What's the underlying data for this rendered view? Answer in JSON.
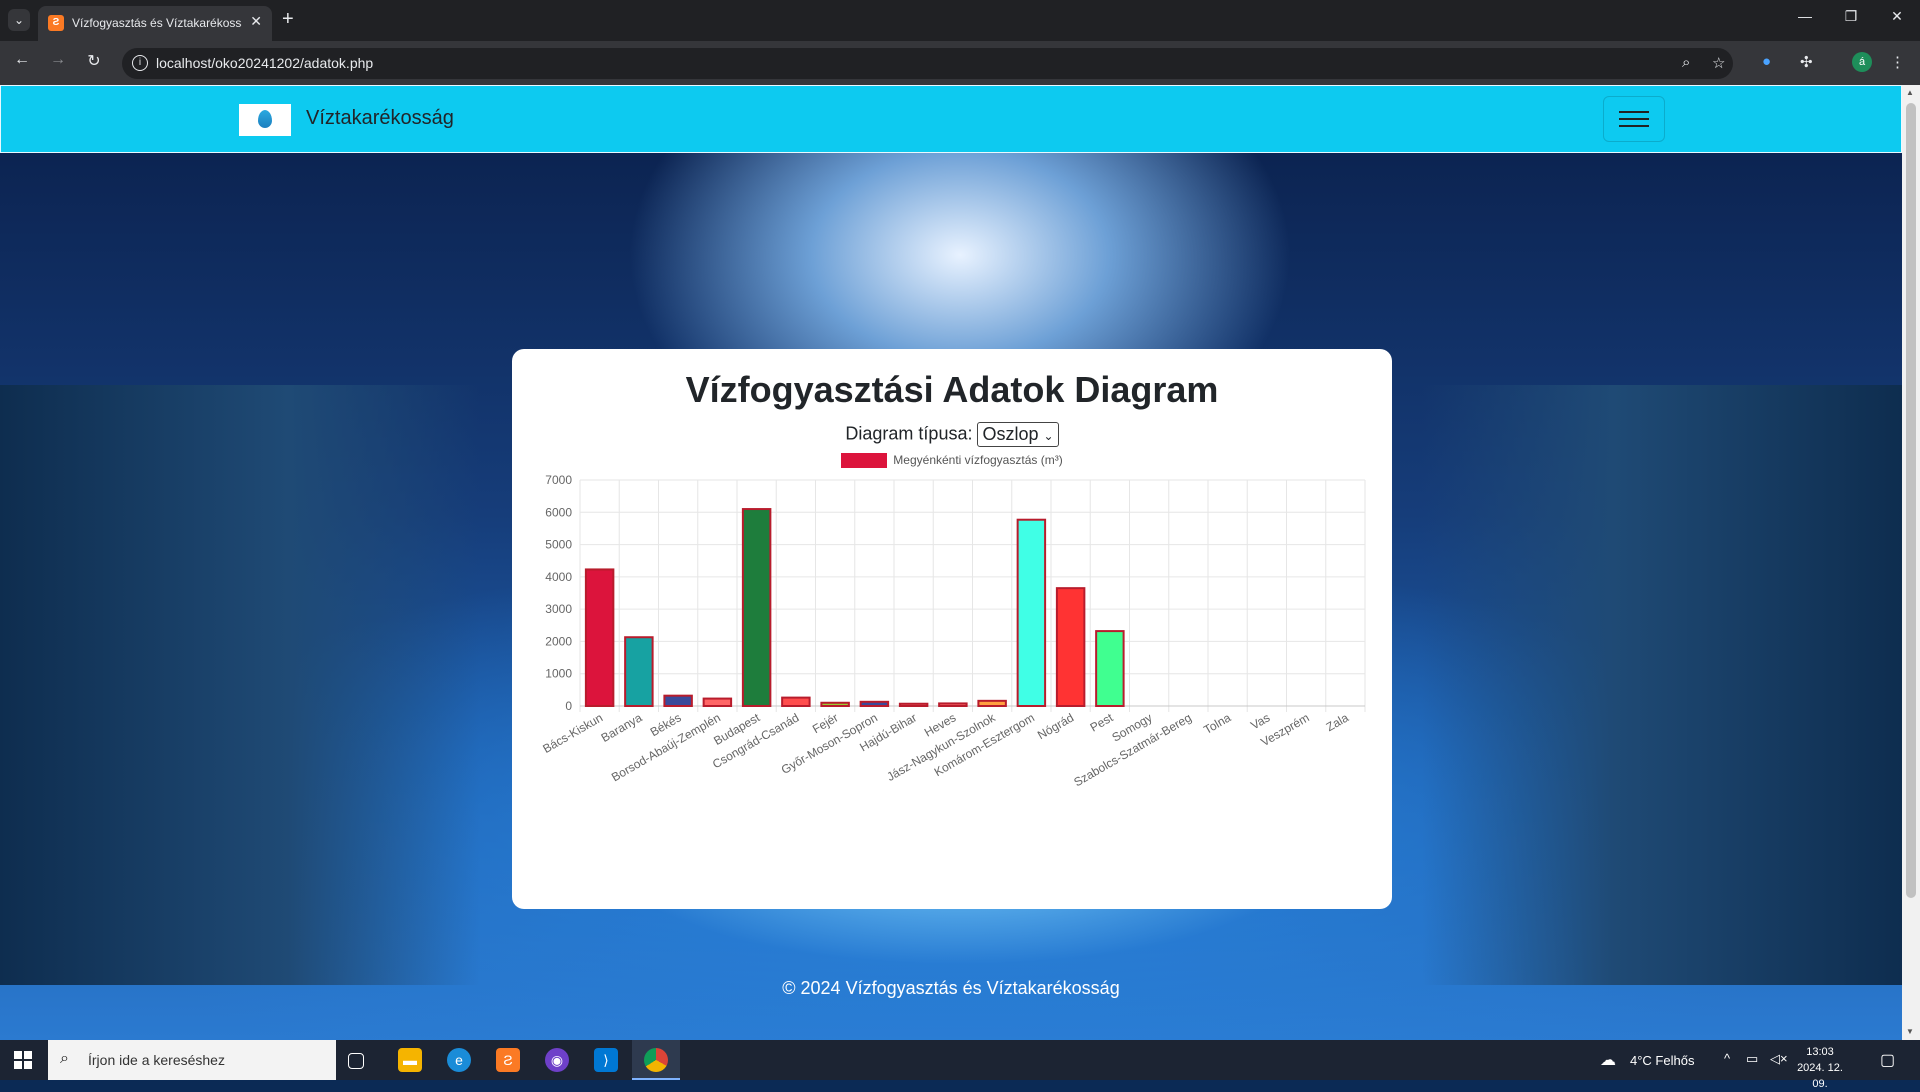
{
  "browser": {
    "tab_title": "Vízfogyasztás és Víztakarékosság",
    "tab_favicon": "xampp-icon",
    "url": "localhost/oko20241202/adatok.php",
    "profile_initial": "á"
  },
  "navbar": {
    "brand": "Víztakarékosság"
  },
  "card": {
    "title": "Vízfogyasztási Adatok Diagram",
    "type_label": "Diagram típusa:",
    "type_selected": "Oszlop"
  },
  "chart_data": {
    "type": "bar",
    "legend": [
      "Megyénkénti vízfogyasztás (m³)"
    ],
    "categories": [
      "Bács-Kiskun",
      "Baranya",
      "Békés",
      "Borsod-Abaúj-Zemplén",
      "Budapest",
      "Csongrád-Csanád",
      "Fejér",
      "Győr-Moson-Sopron",
      "Hajdú-Bihar",
      "Heves",
      "Jász-Nagykun-Szolnok",
      "Komárom-Esztergom",
      "Nógrád",
      "Pest",
      "Somogy",
      "Szabolcs-Szatmár-Bereg",
      "Tolna",
      "Vas",
      "Veszprém",
      "Zala"
    ],
    "series": [
      {
        "name": "Megyénkénti vízfogyasztás (m³)",
        "values": [
          4230,
          2130,
          320,
          230,
          6100,
          260,
          100,
          130,
          70,
          80,
          160,
          5770,
          3650,
          2320,
          0,
          0,
          0,
          0,
          0,
          0
        ]
      }
    ],
    "colors": [
      "#dc143c",
      "#17a2a2",
      "#3a4a9a",
      "#ff6666",
      "#1e7d3c",
      "#ff4d4d",
      "#9acd32",
      "#3a4a9a",
      "#ff6666",
      "#ff6666",
      "#ffa040",
      "#40ffe6",
      "#ff3333",
      "#40ff90",
      "#999999",
      "#999999",
      "#999999",
      "#999999",
      "#999999",
      "#999999"
    ],
    "yticks": [
      0,
      1000,
      2000,
      3000,
      4000,
      5000,
      6000,
      7000
    ],
    "ylim": [
      0,
      7000
    ],
    "grid": true
  },
  "footer": {
    "text": "© 2024 Vízfogyasztás és Víztakarékosság"
  },
  "taskbar": {
    "search_placeholder": "Írjon ide a kereséshez",
    "weather": "4°C  Felhős",
    "time": "13:03",
    "date": "2024. 12. 09."
  }
}
